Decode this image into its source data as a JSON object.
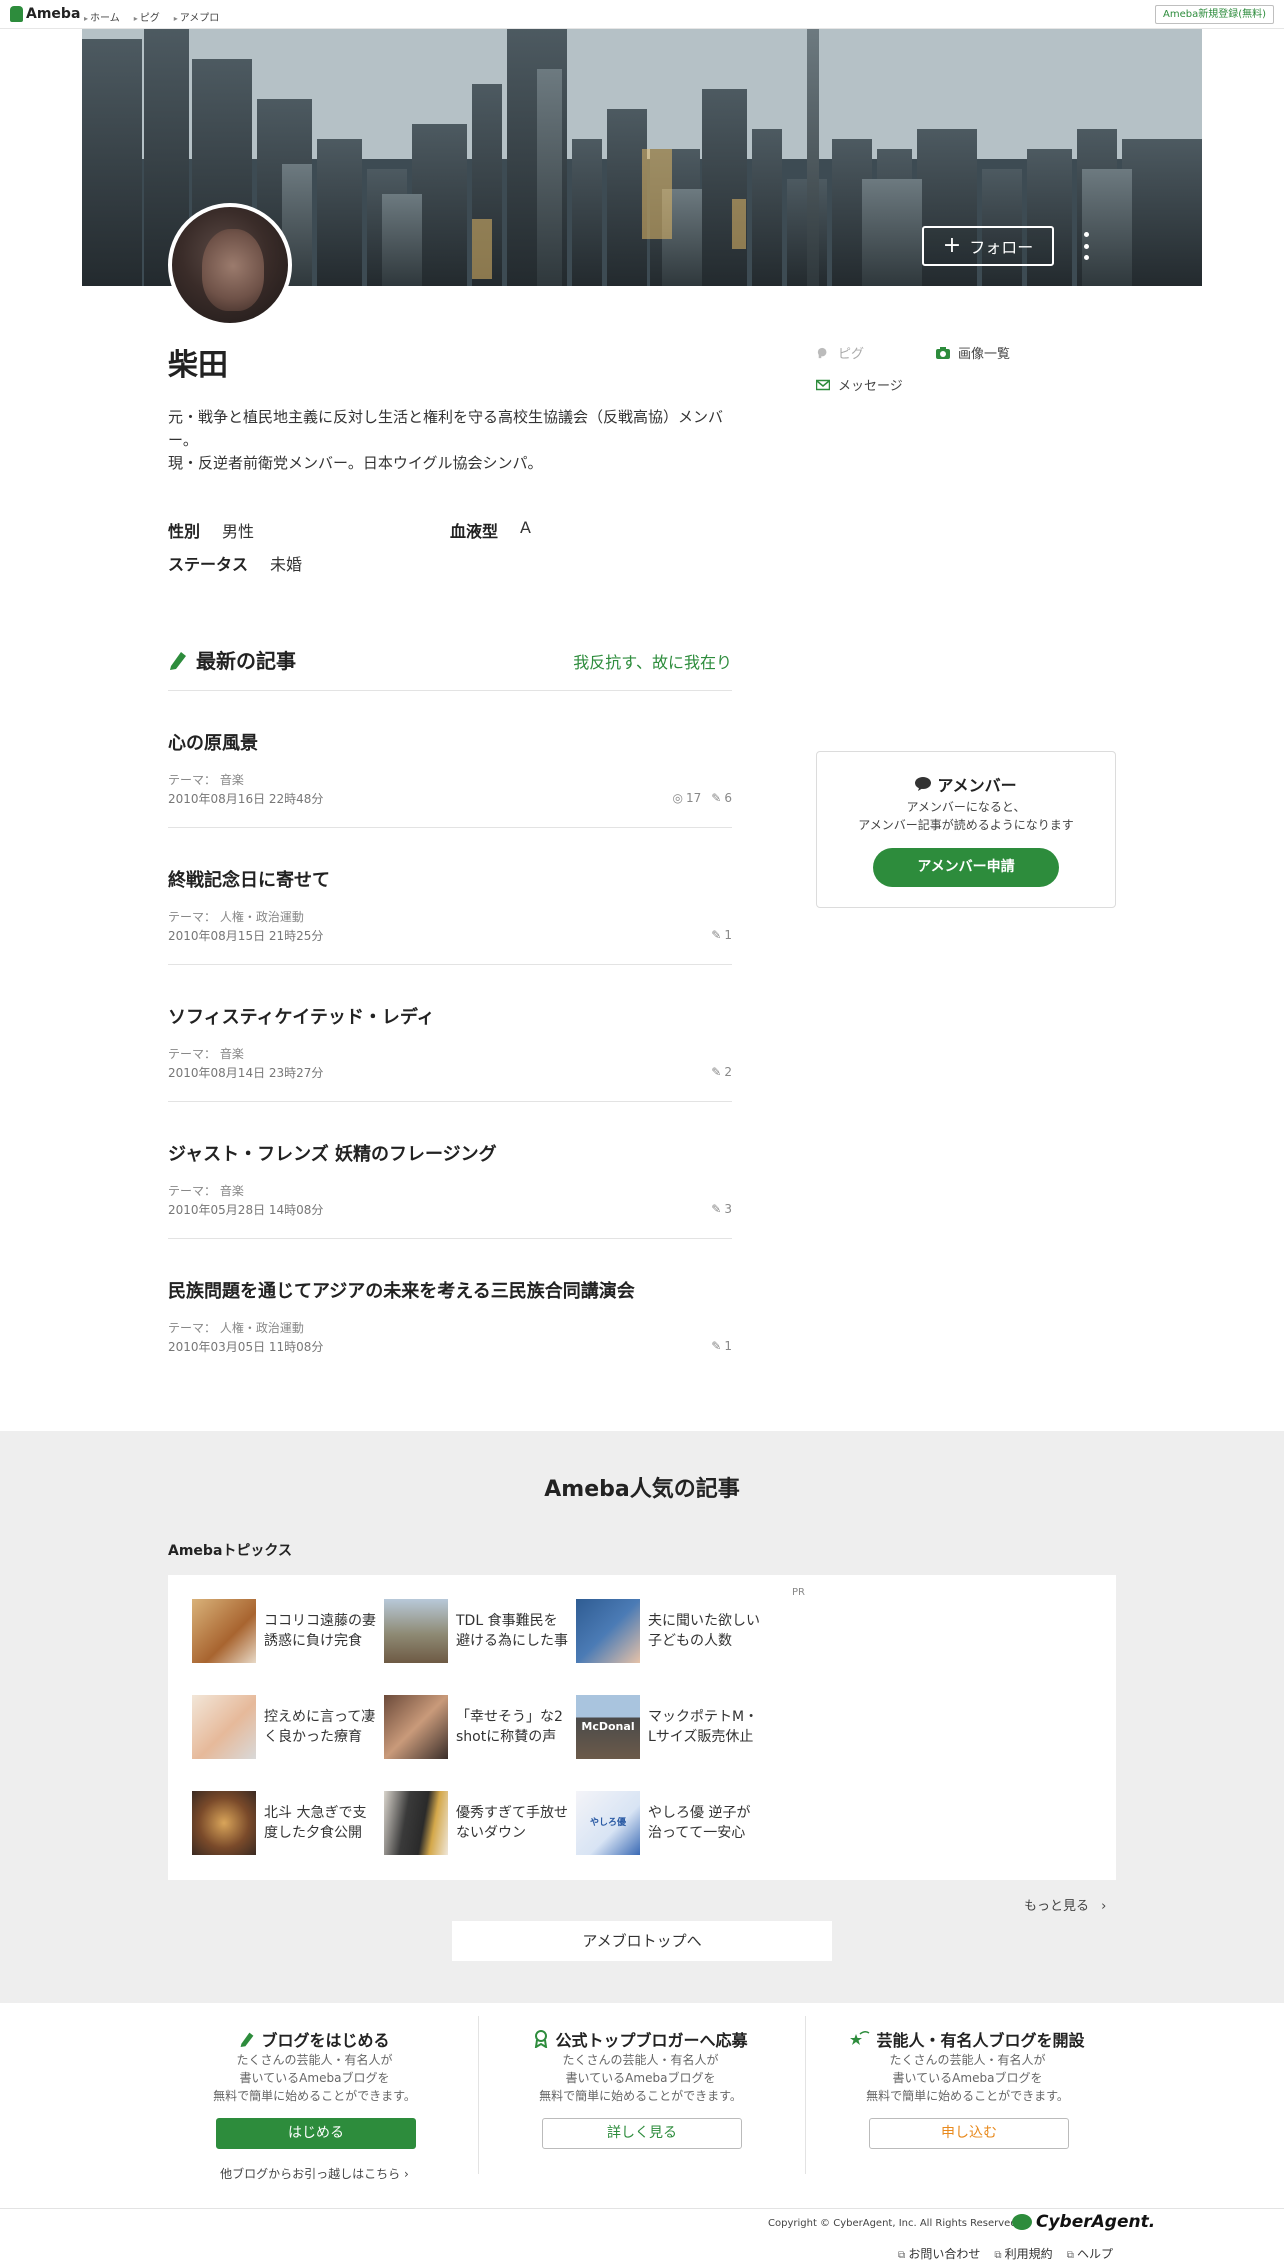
{
  "topbar": {
    "logo": "Ameba",
    "nav": [
      "ホーム",
      "ピグ",
      "アメプロ"
    ],
    "signup": "Ameba新規登録(無料)"
  },
  "header": {
    "follow_label": "フォロー"
  },
  "profile": {
    "name": "柴田",
    "bio_line1": "元・戦争と植民地主義に反対し生活と権利を守る高校生協議会（反戦高協）メンバー。",
    "bio_line2": "現・反逆者前衛党メンバー。日本ウイグル協会シンパ。",
    "attrs": {
      "gender_label": "性別",
      "gender": "男性",
      "blood_label": "血液型",
      "blood": "A",
      "status_label": "ステータス",
      "status": "未婚"
    }
  },
  "side": {
    "pigg": "ピグ",
    "images": "画像一覧",
    "message": "メッセージ"
  },
  "latest": {
    "title": "最新の記事",
    "blog_link": "我反抗す、故に我在り",
    "posts": [
      {
        "title": "心の原風景",
        "theme": "テーマ： 音楽",
        "date": "2010年08月16日 22時48分",
        "views": "17",
        "comments": "6"
      },
      {
        "title": "終戦記念日に寄せて",
        "theme": "テーマ： 人権・政治運動",
        "date": "2010年08月15日 21時25分",
        "comments": "1"
      },
      {
        "title": "ソフィスティケイテッド・レディ",
        "theme": "テーマ： 音楽",
        "date": "2010年08月14日 23時27分",
        "comments": "2"
      },
      {
        "title": "ジャスト・フレンズ 妖精のフレージング",
        "theme": "テーマ： 音楽",
        "date": "2010年05月28日 14時08分",
        "comments": "3"
      },
      {
        "title": "民族問題を通じてアジアの未来を考える三民族合同講演会",
        "theme": "テーマ： 人権・政治運動",
        "date": "2010年03月05日 11時08分",
        "comments": "1"
      }
    ]
  },
  "amember": {
    "title": "アメンバー",
    "desc1": "アメンバーになると、",
    "desc2": "アメンバー記事が読めるようになります",
    "button": "アメンバー申請"
  },
  "popular": {
    "title": "Ameba人気の記事",
    "topics_label": "Amebaトピックス",
    "pr": "PR",
    "topics": [
      {
        "line1": "ココリコ遠藤の妻",
        "line2": "誘惑に負け完食"
      },
      {
        "line1": "TDL 食事難民を",
        "line2": "避ける為にした事"
      },
      {
        "line1": "夫に聞いた欲しい",
        "line2": "子どもの人数"
      },
      {
        "line1": "控えめに言って凄",
        "line2": "く良かった療育"
      },
      {
        "line1": "「幸せそう」な2",
        "line2": "shotに称賛の声"
      },
      {
        "line1": "マックポテトM・",
        "line2": "Lサイズ販売休止"
      },
      {
        "line1": "北斗 大急ぎで支",
        "line2": "度した夕食公開"
      },
      {
        "line1": "優秀すぎて手放せ",
        "line2": "ないダウン"
      },
      {
        "line1": "やしろ優 逆子が",
        "line2": "治ってて一安心"
      }
    ],
    "thumb_text": {
      "mcd": "McDonal",
      "yashiro": "やしろ優"
    },
    "more": "もっと見る",
    "top_button": "アメブロトップへ"
  },
  "promos": [
    {
      "title": "ブログをはじめる",
      "d1": "たくさんの芸能人・有名人が",
      "d2": "書いているAmebaブログを",
      "d3": "無料で簡単に始めることができます。",
      "button": "はじめる",
      "sub": "他ブログからお引っ越しはこちら"
    },
    {
      "title": "公式トップブロガーへ応募",
      "d1": "たくさんの芸能人・有名人が",
      "d2": "書いているAmebaブログを",
      "d3": "無料で簡単に始めることができます。",
      "button": "詳しく見る"
    },
    {
      "title": "芸能人・有名人ブログを開設",
      "d1": "たくさんの芸能人・有名人が",
      "d2": "書いているAmebaブログを",
      "d3": "無料で簡単に始めることができます。",
      "button": "申し込む"
    }
  ],
  "footer": {
    "copyright": "Copyright © CyberAgent, Inc. All Rights Reserved.",
    "brand": "CyberAgent.",
    "links": [
      "お問い合わせ",
      "利用規約",
      "ヘルプ"
    ]
  },
  "colors": {
    "accent": "#2d8c3c",
    "orange": "#e8891c"
  }
}
